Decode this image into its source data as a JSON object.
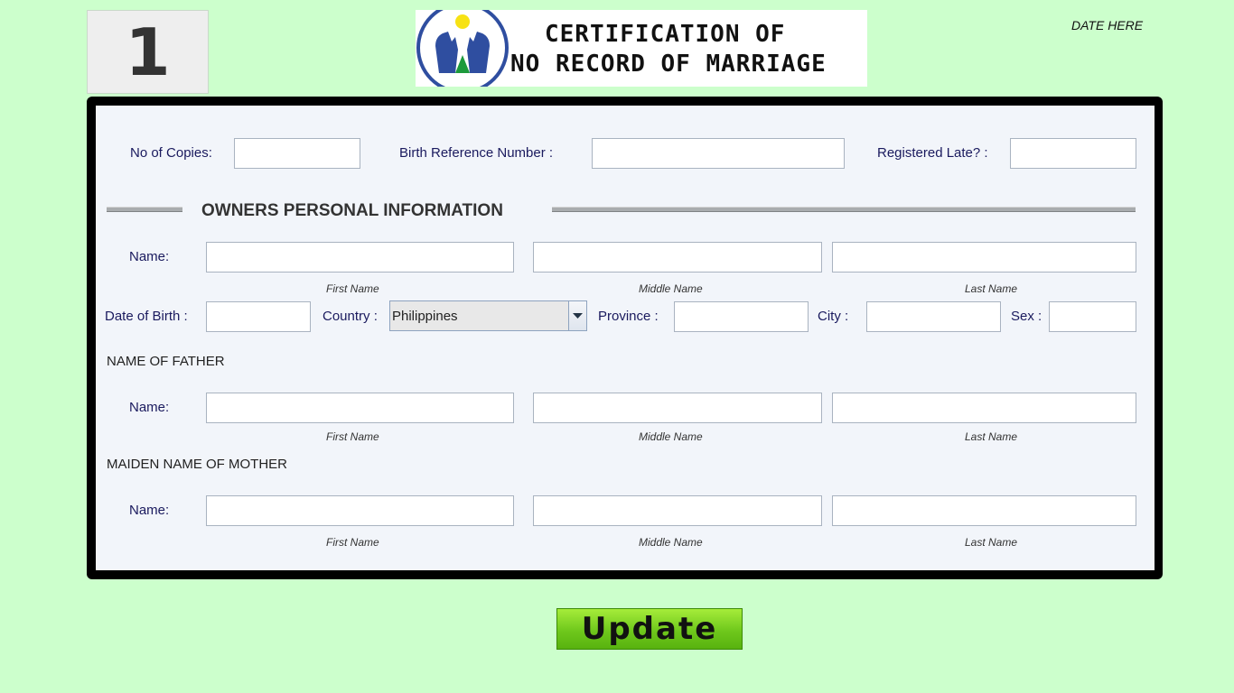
{
  "record_number": "1",
  "header": {
    "title_line1": "CERTIFICATION OF",
    "title_line2": "NO RECORD OF MARRIAGE",
    "logo_icon": "hands-logo-icon",
    "date": "DATE HERE"
  },
  "top_fields": {
    "copies_label": "No of Copies:",
    "copies_value": "",
    "birth_ref_label": "Birth Reference Number :",
    "birth_ref_value": "",
    "late_label": "Registered Late? :",
    "late_value": ""
  },
  "owner": {
    "section_title": "OWNERS PERSONAL INFORMATION",
    "name_label": "Name:",
    "first_name": "",
    "middle_name": "",
    "last_name": "",
    "first_caption": "First Name",
    "middle_caption": "Middle Name",
    "last_caption": "Last Name",
    "dob_label": "Date of Birth :",
    "dob_value": "",
    "country_label": "Country :",
    "country_value": "Philippines",
    "province_label": "Province :",
    "province_value": "",
    "city_label": "City :",
    "city_value": "",
    "sex_label": "Sex :",
    "sex_value": ""
  },
  "father": {
    "section_title": "NAME OF FATHER",
    "name_label": "Name:",
    "first_name": "",
    "middle_name": "",
    "last_name": "",
    "first_caption": "First Name",
    "middle_caption": "Middle Name",
    "last_caption": "Last Name"
  },
  "mother": {
    "section_title": "MAIDEN NAME OF MOTHER",
    "name_label": "Name:",
    "first_name": "",
    "middle_name": "",
    "last_name": "",
    "first_caption": "First Name",
    "middle_caption": "Middle Name",
    "last_caption": "Last Name"
  },
  "actions": {
    "update_label": "Update"
  },
  "colors": {
    "background": "#ccffcc",
    "panel": "#f2f5fa",
    "label_text": "#1a1a5e",
    "button_green": "#6fc81c"
  }
}
